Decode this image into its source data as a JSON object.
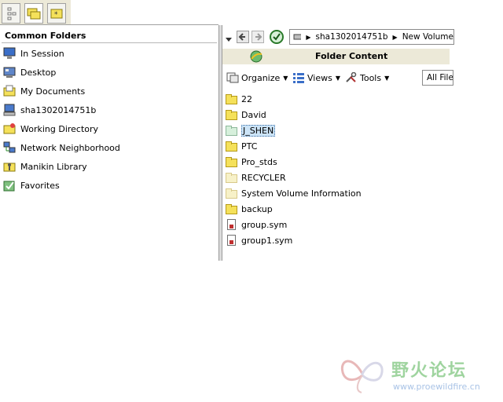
{
  "left_panel": {
    "title": "Common Folders",
    "items": [
      {
        "label": "In Session",
        "icon": "monitor-icon"
      },
      {
        "label": "Desktop",
        "icon": "desktop-icon"
      },
      {
        "label": "My Documents",
        "icon": "documents-icon"
      },
      {
        "label": "sha1302014751b",
        "icon": "computer-icon"
      },
      {
        "label": "Working Directory",
        "icon": "working-directory-icon"
      },
      {
        "label": "Network Neighborhood",
        "icon": "network-icon"
      },
      {
        "label": "Manikin Library",
        "icon": "library-icon"
      },
      {
        "label": "Favorites",
        "icon": "favorites-icon"
      }
    ]
  },
  "breadcrumb": {
    "parts": [
      "sha1302014751b",
      "New Volume"
    ]
  },
  "folder_content": {
    "title": "Folder Content"
  },
  "toolbar": {
    "organize_label": "Organize",
    "views_label": "Views",
    "tools_label": "Tools",
    "filter_value": "All File"
  },
  "files": [
    {
      "name": "22",
      "type": "folder"
    },
    {
      "name": "David",
      "type": "folder"
    },
    {
      "name": "J_SHEN",
      "type": "folder",
      "selected": true
    },
    {
      "name": "PTC",
      "type": "folder"
    },
    {
      "name": "Pro_stds",
      "type": "folder"
    },
    {
      "name": "RECYCLER",
      "type": "folder-pale"
    },
    {
      "name": "System Volume Information",
      "type": "folder-pale"
    },
    {
      "name": "backup",
      "type": "folder"
    },
    {
      "name": "group.sym",
      "type": "file"
    },
    {
      "name": "group1.sym",
      "type": "file"
    }
  ],
  "watermark": {
    "text": "野火论坛",
    "url": "www.proewildfire.cn"
  },
  "colors": {
    "panel_header": "#ece9d8",
    "selection": "#cce4f7",
    "folder": "#f5e15a"
  }
}
